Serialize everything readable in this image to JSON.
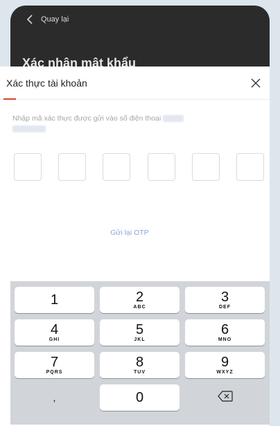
{
  "topbar": {
    "back_label": "Quay lại"
  },
  "background": {
    "title": "Xác nhận mật khẩu"
  },
  "sheet": {
    "title": "Xác thực tài khoản",
    "instruction": "Nhập mã xác thực được gửi vào số điện thoại",
    "otp_count": 6,
    "resend_label": "Gửi lại OTP"
  },
  "colors": {
    "accent": "#d6422d",
    "link": "#8aa6d8",
    "keyboard_bg": "#d1d4d9"
  },
  "keyboard": {
    "keys": [
      {
        "num": "1",
        "letters": ""
      },
      {
        "num": "2",
        "letters": "ABC"
      },
      {
        "num": "3",
        "letters": "DEF"
      },
      {
        "num": "4",
        "letters": "GHI"
      },
      {
        "num": "5",
        "letters": "JKL"
      },
      {
        "num": "6",
        "letters": "MNO"
      },
      {
        "num": "7",
        "letters": "PQRS"
      },
      {
        "num": "8",
        "letters": "TUV"
      },
      {
        "num": "9",
        "letters": "WXYZ"
      },
      {
        "num": ",",
        "letters": ""
      },
      {
        "num": "0",
        "letters": ""
      },
      {
        "num": "",
        "letters": "",
        "icon": "backspace-icon"
      }
    ]
  }
}
